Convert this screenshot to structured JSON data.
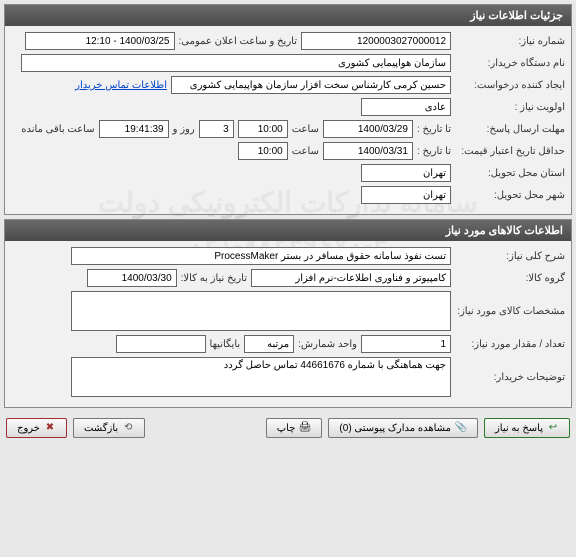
{
  "watermark_line1": "سامانه تدارکات الکترونیکی دولت",
  "watermark_line2": "۰۲۱-۸۸۲۴۹۶۷۰-۴",
  "panel1": {
    "title": "جزئیات اطلاعات نیاز",
    "request_no_label": "شماره نیاز:",
    "request_no": "1200003027000012",
    "announce_label": "تاریخ و ساعت اعلان عمومی:",
    "announce_value": "1400/03/25 - 12:10",
    "buyer_label": "نام دستگاه خریدار:",
    "buyer_value": "سازمان هواپیمایی کشوری",
    "creator_label": "ایجاد کننده درخواست:",
    "creator_value": "حسین کرمی کارشناس سخت افزار سازمان هواپیمایی کشوری",
    "contact_link": "اطلاعات تماس خریدار",
    "priority_label": "اولویت نیاز :",
    "priority_value": "عادی",
    "deadline_label": "مهلت ارسال پاسخ:",
    "until_label": "تا تاریخ :",
    "deadline_date": "1400/03/29",
    "time_label": "ساعت",
    "deadline_time": "10:00",
    "days_remaining": "3",
    "day_and_label": "روز و",
    "countdown": "19:41:39",
    "hours_remaining_label": "ساعت باقی مانده",
    "validity_label": "حداقل تاریخ اعتبار قیمت:",
    "validity_date": "1400/03/31",
    "validity_time": "10:00",
    "delivery_province_label": "استان محل تحویل:",
    "delivery_province": "تهران",
    "delivery_city_label": "شهر محل تحویل:",
    "delivery_city": "تهران"
  },
  "panel2": {
    "title": "اطلاعات کالاهای مورد نیاز",
    "general_desc_label": "شرح کلی نیاز:",
    "general_desc": "تست نفوذ سامانه حقوق مسافر در بستر ProcessMaker",
    "group_label": "گروه کالا:",
    "group_value": "کامپیوتر و فناوری اطلاعات-نرم افزار",
    "need_by_label": "تاریخ نیاز به کالا:",
    "need_by_date": "1400/03/30",
    "specs_label": "مشخصات کالای مورد نیاز:",
    "specs_value": "",
    "qty_label": "تعداد / مقدار مورد نیاز:",
    "qty_value": "1",
    "unit_label": "واحد شمارش:",
    "unit_value": "مرتبه",
    "packaging_label": "بایگانیها",
    "notes_label": "توضیحات خریدار:",
    "notes_value": "جهت هماهنگی با شماره 44661676 تماس حاصل گردد"
  },
  "buttons": {
    "reply": "پاسخ به نیاز",
    "attachments": "مشاهده مدارک پیوستی (0)",
    "print": "چاپ",
    "back": "بازگشت",
    "exit": "خروج"
  }
}
